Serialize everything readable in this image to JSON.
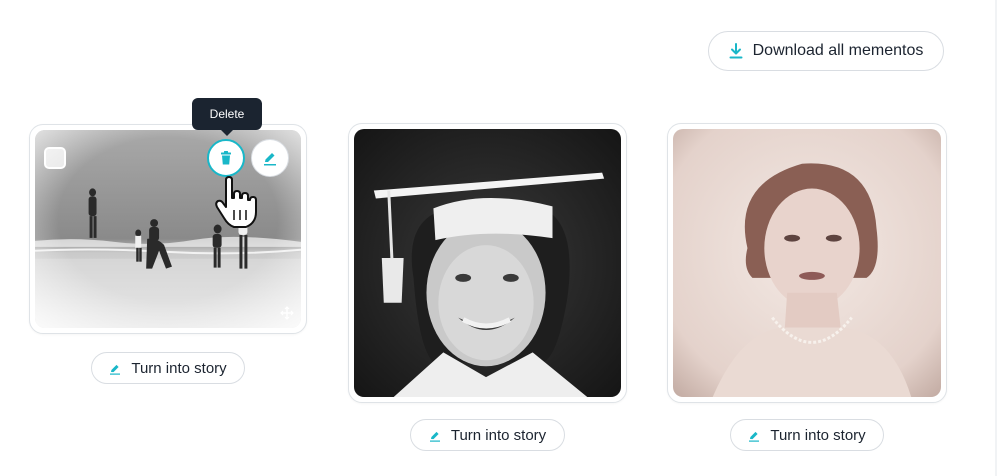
{
  "toolbar": {
    "download_label": "Download all mementos",
    "download_icon": "download-icon"
  },
  "mementos": [
    {
      "photo_subject": "beach scene",
      "story_label": "Turn into story",
      "tooltip": "Delete",
      "selected": false
    },
    {
      "photo_subject": "graduation portrait",
      "story_label": "Turn into story"
    },
    {
      "photo_subject": "vintage portrait",
      "story_label": "Turn into story"
    }
  ],
  "colors": {
    "accent": "#19b7c8",
    "tooltip_bg": "#1b2430",
    "border": "#d9dde2",
    "text": "#1c2430"
  }
}
